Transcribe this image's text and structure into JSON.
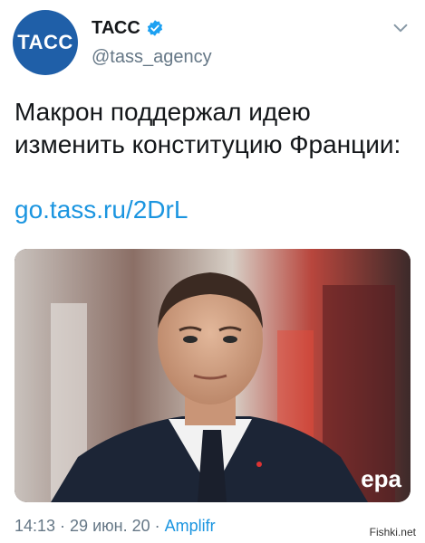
{
  "account": {
    "avatar_text": "TACC",
    "display_name": "ТАСС",
    "handle": "@tass_agency",
    "verified": true
  },
  "tweet": {
    "text": "Макрон поддержал идею изменить конституцию Франции:",
    "link": "go.tass.ru/2DrL"
  },
  "photo": {
    "credit": "epa"
  },
  "meta": {
    "time": "14:13",
    "separator1": " · ",
    "date": "29 июн. 20",
    "separator2": " · ",
    "source": "Amplifr"
  },
  "watermark": "Fishki.net",
  "colors": {
    "brand": "#1f5fa8",
    "link": "#1b95e0",
    "muted": "#657786"
  },
  "icons": {
    "verified": "verified-badge-icon",
    "chevron": "chevron-down-icon"
  }
}
